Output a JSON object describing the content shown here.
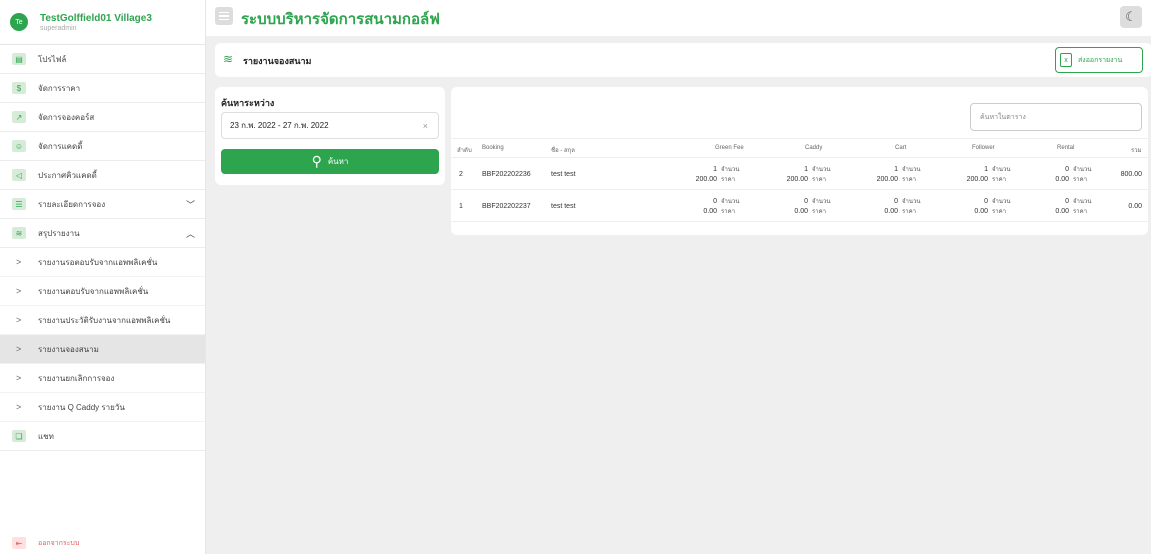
{
  "sidebar": {
    "profile": {
      "avatar": "Te",
      "name": "TestGolffield01 Village3",
      "role": "superadmin"
    },
    "items": [
      {
        "label": "โปรไฟล์",
        "icon": "id-card-icon"
      },
      {
        "label": "จัดการราคา",
        "icon": "dollar-icon"
      },
      {
        "label": "จัดการจองคอร์ส",
        "icon": "trend-icon"
      },
      {
        "label": "จัดการแคดดี้",
        "icon": "users-icon"
      },
      {
        "label": "ประกาศคิวแคดดี้",
        "icon": "announce-icon"
      },
      {
        "label": "รายละเอียดการจอง",
        "icon": "list-icon",
        "chevron": "﹀"
      },
      {
        "label": "สรุปรายงาน",
        "icon": "layers-icon",
        "chevron": "︿"
      }
    ],
    "sub_items": [
      {
        "label": "รายงานรอตอบรับจากแอพพลิเคชั่น"
      },
      {
        "label": "รายงานตอบรับจากแอพพลิเคชั่น"
      },
      {
        "label": "รายงานประวัติรับงานจากแอพพลิเคชั่น"
      },
      {
        "label": "รายงานจองสนาม"
      },
      {
        "label": "รายงานยกเลิกการจอง"
      },
      {
        "label": "รายงาน Q Caddy รายวัน"
      }
    ],
    "chat": {
      "label": "แชท",
      "icon": "chat-icon"
    },
    "logout": {
      "label": "ออกจากระบบ",
      "icon": "logout-icon"
    }
  },
  "topbar": {
    "title": "ระบบบริหารจัดการสนามกอล์ฟ",
    "theme_icon": "moon-icon"
  },
  "header": {
    "title": "รายงานจองสนาม",
    "export_label": "ส่งออกรายงาน"
  },
  "search": {
    "label": "ค้นหาระหว่าง",
    "date_range": "23 ก.พ. 2022 - 27 ก.พ. 2022",
    "clear": "×",
    "button_label": "ค้นหา"
  },
  "table": {
    "filter_placeholder": "ค้นหาในตาราง",
    "qty_label": "จำนวน",
    "price_label": "ราคา",
    "columns": [
      "ลำดับ",
      "Booking",
      "ชื่อ - สกุล",
      "Green Fee",
      "Caddy",
      "Cart",
      "Follower",
      "Rental",
      "รวม"
    ],
    "rows": [
      {
        "no": "2",
        "booking": "BBF202202236",
        "name": "test test",
        "green_fee": {
          "qty": "1",
          "price": "200.00"
        },
        "caddy": {
          "qty": "1",
          "price": "200.00"
        },
        "cart": {
          "qty": "1",
          "price": "200.00"
        },
        "follower": {
          "qty": "1",
          "price": "200.00"
        },
        "rental": {
          "qty": "0",
          "price": "0.00"
        },
        "total": "800.00"
      },
      {
        "no": "1",
        "booking": "BBF202202237",
        "name": "test test",
        "green_fee": {
          "qty": "0",
          "price": "0.00"
        },
        "caddy": {
          "qty": "0",
          "price": "0.00"
        },
        "cart": {
          "qty": "0",
          "price": "0.00"
        },
        "follower": {
          "qty": "0",
          "price": "0.00"
        },
        "rental": {
          "qty": "0",
          "price": "0.00"
        },
        "total": "0.00"
      }
    ]
  },
  "colors": {
    "accent": "#2da44e",
    "logout": "#e35d5d",
    "background": "#efefef"
  }
}
